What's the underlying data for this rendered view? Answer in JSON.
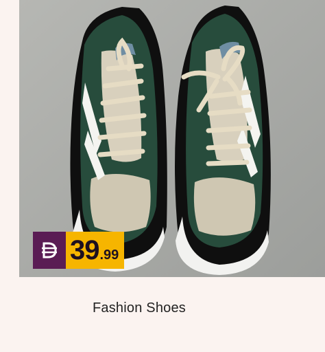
{
  "product": {
    "name": "Fashion Shoes",
    "price_integer": "39",
    "price_decimal": ".99",
    "currency_icon": "dirham-symbol-icon"
  },
  "colors": {
    "background": "#fbf3f0",
    "currency_badge": "#5a1c54",
    "price_badge": "#f6b500"
  }
}
